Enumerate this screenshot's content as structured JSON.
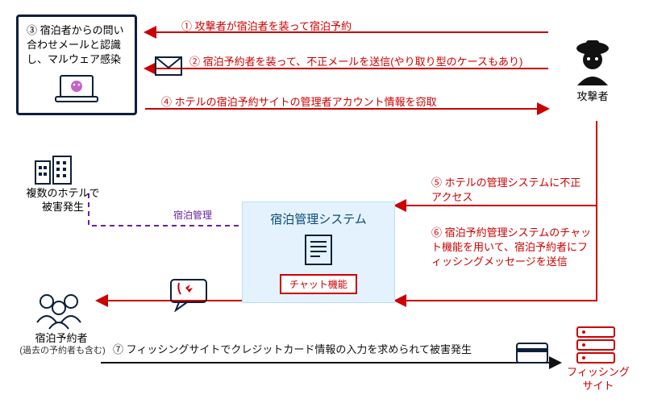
{
  "attacker_label": "攻撃者",
  "hotel_group_caption": "③ 宿泊者からの問い合わせメールと認識し、マルウェア感染",
  "hotels_damage_label": "複数のホテルで被害発生",
  "guests_label": "宿泊予約者",
  "guests_sub": "(過去の予約者も含む)",
  "phishing_site_label": "フィッシングサイト",
  "mgmt_title": "宿泊管理システム",
  "chat_tag": "チャット機能",
  "mgmt_link_label": "宿泊管理",
  "steps": {
    "s1": "① 攻撃者が宿泊者を装って宿泊予約",
    "s2": "② 宿泊予約者を装って、不正メールを送信(やり取り型のケースもあり)",
    "s4": "④ ホテルの宿泊予約サイトの管理者アカウント情報を窃取",
    "s5": "⑤ ホテルの管理システムに不正アクセス",
    "s6": "⑥ 宿泊予約管理システムのチャット機能を用いて、宿泊予約者にフィッシングメッセージを送信",
    "s7": "⑦ フィッシングサイトでクレジットカード情報の入力を求められて被害発生"
  },
  "colors": {
    "red": "#c00",
    "navy": "#0b1f3a",
    "purple": "#6a1fa0",
    "mgmt_bg": "#e3f2fc"
  }
}
